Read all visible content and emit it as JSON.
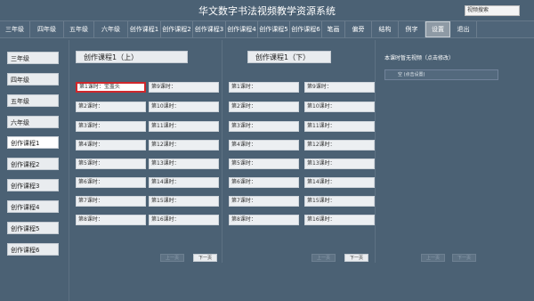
{
  "app": {
    "title": "华文数字书法视频教学资源系统",
    "search_value": "视频搜索"
  },
  "nav": {
    "tabs": [
      {
        "label": "三年级"
      },
      {
        "label": "四年级"
      },
      {
        "label": "五年级"
      },
      {
        "label": "六年级"
      },
      {
        "label": "创作课程1"
      },
      {
        "label": "创作课程2"
      },
      {
        "label": "创作课程3"
      },
      {
        "label": "创作课程4"
      },
      {
        "label": "创作课程5"
      },
      {
        "label": "创作课程6"
      },
      {
        "label": "笔画"
      },
      {
        "label": "偏旁"
      },
      {
        "label": "结构"
      },
      {
        "label": "例字"
      },
      {
        "label": "设置"
      },
      {
        "label": "退出"
      }
    ],
    "active_tab": "设置"
  },
  "sidebar": {
    "items": [
      {
        "label": "三年级"
      },
      {
        "label": "四年级"
      },
      {
        "label": "五年级"
      },
      {
        "label": "六年级"
      },
      {
        "label": "创作课程1"
      },
      {
        "label": "创作课程2"
      },
      {
        "label": "创作课程3"
      },
      {
        "label": "创作课程4"
      },
      {
        "label": "创作课程5"
      },
      {
        "label": "创作课程6"
      }
    ],
    "active_item": "创作课程1"
  },
  "left_panel": {
    "title": "创作课程1（上）",
    "col1": [
      {
        "label": "第1课时：",
        "value": "宝盖头"
      },
      {
        "label": "第2课时：",
        "value": ""
      },
      {
        "label": "第3课时：",
        "value": ""
      },
      {
        "label": "第4课时：",
        "value": ""
      },
      {
        "label": "第5课时：",
        "value": ""
      },
      {
        "label": "第6课时：",
        "value": ""
      },
      {
        "label": "第7课时：",
        "value": ""
      },
      {
        "label": "第8课时：",
        "value": ""
      }
    ],
    "col2": [
      {
        "label": "第9课时：",
        "value": ""
      },
      {
        "label": "第10课时：",
        "value": ""
      },
      {
        "label": "第11课时：",
        "value": ""
      },
      {
        "label": "第12课时：",
        "value": ""
      },
      {
        "label": "第13课时：",
        "value": ""
      },
      {
        "label": "第14课时：",
        "value": ""
      },
      {
        "label": "第15课时：",
        "value": ""
      },
      {
        "label": "第16课时：",
        "value": ""
      }
    ],
    "prev_label": "上一页",
    "next_label": "下一页"
  },
  "middle_panel": {
    "title": "创作课程1（下）",
    "col1": [
      {
        "label": "第1课时：",
        "value": ""
      },
      {
        "label": "第2课时：",
        "value": ""
      },
      {
        "label": "第3课时：",
        "value": ""
      },
      {
        "label": "第4课时：",
        "value": ""
      },
      {
        "label": "第5课时：",
        "value": ""
      },
      {
        "label": "第6课时：",
        "value": ""
      },
      {
        "label": "第7课时：",
        "value": ""
      },
      {
        "label": "第8课时：",
        "value": ""
      }
    ],
    "col2": [
      {
        "label": "第9课时：",
        "value": ""
      },
      {
        "label": "第10课时：",
        "value": ""
      },
      {
        "label": "第11课时：",
        "value": ""
      },
      {
        "label": "第12课时：",
        "value": ""
      },
      {
        "label": "第13课时：",
        "value": ""
      },
      {
        "label": "第14课时：",
        "value": ""
      },
      {
        "label": "第15课时：",
        "value": ""
      },
      {
        "label": "第16课时：",
        "value": ""
      }
    ],
    "prev_label": "上一页",
    "next_label": "下一页"
  },
  "right_panel": {
    "title": "本课时暂无视频（点击修改）",
    "empty_item": "空 (点击设置)",
    "prev_label": "上一页",
    "next_label": "下一页"
  },
  "colors": {
    "background": "#4b6174",
    "selected_border": "#d0272b"
  }
}
